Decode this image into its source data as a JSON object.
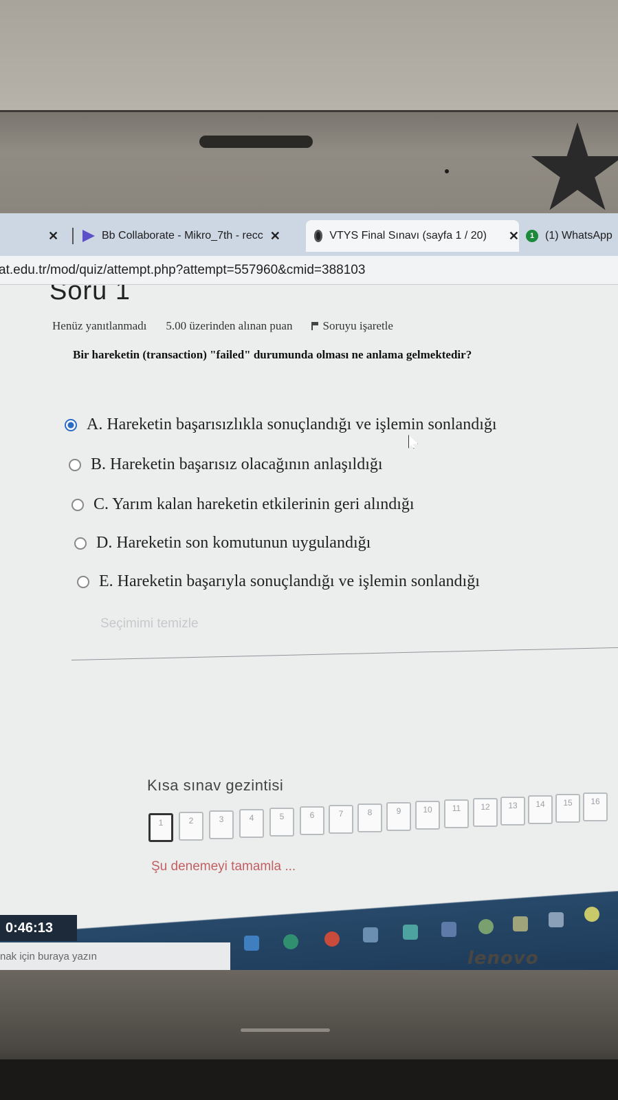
{
  "browser": {
    "tabs": [
      {
        "label": "",
        "close": "✕"
      },
      {
        "label": "Bb Collaborate - Mikro_7th - recc",
        "close": "✕",
        "icon": "collaborate-icon"
      },
      {
        "label": "VTYS Final Sınavı (sayfa 1 / 20)",
        "close": "✕",
        "icon": "moodle-icon"
      },
      {
        "label": "(1) WhatsApp",
        "badge": "1",
        "icon": "whatsapp-icon"
      }
    ],
    "url": "at.edu.tr/mod/quiz/attempt.php?attempt=557960&cmid=388103"
  },
  "quiz": {
    "question_title": "Soru 1",
    "status": "Henüz yanıtlanmadı",
    "points": "5.00 üzerinden alınan puan",
    "flag_label": "Soruyu işaretle",
    "question_text": "Bir hareketin (transaction) \"failed\" durumunda olması ne anlama gelmektedir?",
    "answers": [
      {
        "text": "A. Hareketin başarısızlıkla sonuçlandığı ve işlemin sonlandığı",
        "selected": true
      },
      {
        "text": "B. Hareketin başarısız olacağının anlaşıldığı",
        "selected": false
      },
      {
        "text": "C. Yarım kalan hareketin etkilerinin geri alındığı",
        "selected": false
      },
      {
        "text": "D. Hareketin son komutunun uygulandığı",
        "selected": false
      },
      {
        "text": "E. Hareketin başarıyla sonuçlandığı ve işlemin sonlandığı",
        "selected": false
      }
    ],
    "clear_choice": "Seçimimi temizle"
  },
  "navigation": {
    "title": "Kısa sınav gezintisi",
    "buttons": [
      "1",
      "2",
      "3",
      "4",
      "5",
      "6",
      "7",
      "8",
      "9",
      "10",
      "11",
      "12",
      "13",
      "14",
      "15",
      "16"
    ],
    "current": "1",
    "finish_link": "Şu denemeyi tamamla ..."
  },
  "taskbar": {
    "timer": "0:46:13",
    "search_placeholder": "nak için buraya yazın"
  },
  "device": {
    "brand": "lenovo"
  },
  "colors": {
    "accent": "#2b6cc4",
    "finish_link": "#c25f63",
    "taskbar": "#1d3a58"
  }
}
